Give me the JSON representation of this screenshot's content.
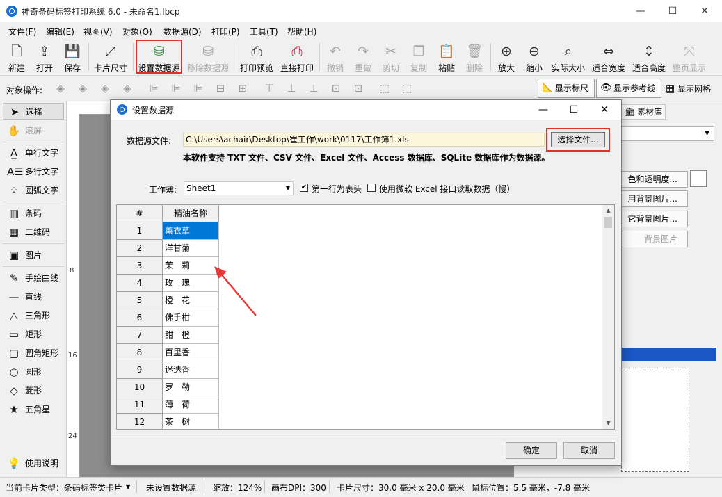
{
  "window": {
    "title": "神奇条码标签打印系统 6.0 - 未命名1.lbcp",
    "minimize": "—",
    "maximize": "☐",
    "close": "✕"
  },
  "menu": [
    "文件(F)",
    "编辑(E)",
    "视图(V)",
    "对象(O)",
    "数据源(D)",
    "打印(P)",
    "工具(T)",
    "帮助(H)"
  ],
  "toolbar": {
    "new": "新建",
    "open": "打开",
    "save": "保存",
    "card_size": "卡片尺寸",
    "set_datasource": "设置数据源",
    "remove_datasource": "移除数据源",
    "print_preview": "打印预览",
    "direct_print": "直接打印",
    "undo": "撤销",
    "redo": "重做",
    "cut": "剪切",
    "copy": "复制",
    "paste": "粘贴",
    "delete": "删除",
    "zoom_in": "放大",
    "zoom_out": "缩小",
    "actual_size": "实际大小",
    "fit_width": "适合宽度",
    "fit_height": "适合高度",
    "whole_page": "整页显示"
  },
  "objbar": {
    "label": "对象操作:",
    "show_ruler": "显示标尺",
    "show_guides": "显示参考线",
    "show_grid": "显示网格"
  },
  "tools": {
    "select": "选择",
    "scroll": "滚屏",
    "single_text": "单行文字",
    "multi_text": "多行文字",
    "arc_text": "圆弧文字",
    "barcode": "条码",
    "qrcode": "二维码",
    "image": "图片",
    "freehand": "手绘曲线",
    "line": "直线",
    "triangle": "三角形",
    "rectangle": "矩形",
    "rounded_rect": "圆角矩形",
    "circle": "圆形",
    "diamond": "菱形",
    "star": "五角星",
    "help": "使用说明"
  },
  "ruler": {
    "left_marks": [
      "8",
      "16",
      "24"
    ]
  },
  "right_panel": {
    "material_tab": "素材库",
    "btn_transparency": "色和透明度...",
    "btn_bg1": "用背景图片...",
    "btn_bg2": "它背景图片...",
    "btn_bg3": "背景图片"
  },
  "dialog": {
    "title": "设置数据源",
    "datasource_label": "数据源文件:",
    "datasource_path": "C:\\Users\\achair\\Desktop\\崔工作\\work\\0117\\工作簿1.xls",
    "choose_file": "选择文件...",
    "support_note": "本软件支持 TXT 文件、CSV 文件、Excel 文件、Access 数据库、SQLite 数据库作为数据源。",
    "workbook_label": "工作薄:",
    "workbook_value": "Sheet1",
    "first_row_header": "第一行为表头",
    "first_row_header_checked": "✔",
    "use_ms_excel": "使用微软 Excel 接口读取数据（慢）",
    "ok": "确定",
    "cancel": "取消",
    "grid": {
      "headers": [
        "#",
        "精油名称"
      ],
      "rows": [
        [
          "1",
          "薰衣草"
        ],
        [
          "2",
          "洋甘菊"
        ],
        [
          "3",
          "茉　莉"
        ],
        [
          "4",
          "玫　瑰"
        ],
        [
          "5",
          "橙　花"
        ],
        [
          "6",
          "佛手柑"
        ],
        [
          "7",
          "甜　橙"
        ],
        [
          "8",
          "百里香"
        ],
        [
          "9",
          "迷迭香"
        ],
        [
          "10",
          "罗　勒"
        ],
        [
          "11",
          "薄　荷"
        ],
        [
          "12",
          "茶　树"
        ]
      ]
    }
  },
  "status": {
    "card_type": "当前卡片类型：条码标签类卡片",
    "datasource": "未设置数据源",
    "zoom": "缩放：124%",
    "dpi": "画布DPI：300",
    "card_size": "卡片尺寸：30.0 毫米 x 20.0 毫米",
    "mouse_pos": "鼠标位置：5.5 毫米，-7.8 毫米"
  }
}
